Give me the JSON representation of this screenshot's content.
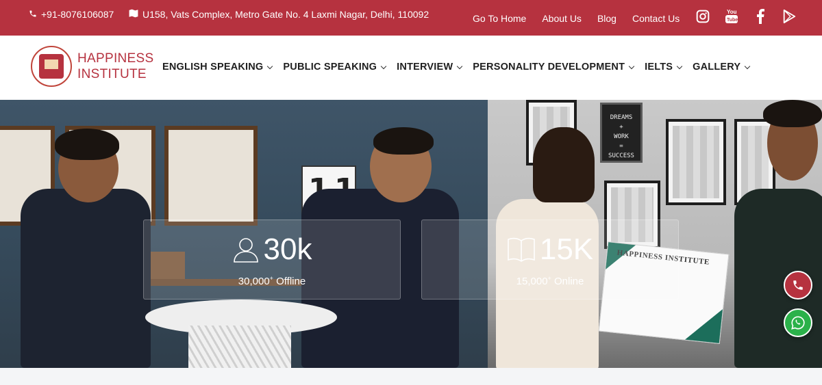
{
  "topbar": {
    "phone": "+91-8076106087",
    "address": "U158, Vats Complex, Metro Gate No. 4 Laxmi Nagar, Delhi, 110092",
    "links": [
      "Go To Home",
      "About Us",
      "Blog",
      "Contact Us"
    ],
    "social_icons": [
      "instagram-icon",
      "youtube-icon",
      "facebook-icon",
      "play-store-icon"
    ],
    "bg_color": "#b6323f"
  },
  "header": {
    "logo_line1": "HAPPINESS",
    "logo_line2": "INSTITUTE",
    "nav": [
      "ENGLISH SPEAKING",
      "PUBLIC SPEAKING",
      "INTERVIEW",
      "PERSONALITY DEVELOPMENT",
      "IELTS",
      "GALLERY"
    ]
  },
  "hero": {
    "clock_digits": [
      "1",
      "1"
    ],
    "board_text": [
      "DREAMS",
      "+",
      "WORK",
      "=",
      "SUCCESS"
    ],
    "certificate_title": "HAPPINESS INSTITUTE",
    "stats": [
      {
        "icon": "user-icon",
        "big": "30k",
        "sub_number": "30,000",
        "sub_sup": "+",
        "sub_label": "Offline"
      },
      {
        "icon": "book-icon",
        "big": "15K",
        "sub_number": "15,000",
        "sub_sup": "+",
        "sub_label": "Online"
      }
    ]
  },
  "floating": {
    "phone_icon": "phone-icon",
    "whatsapp_icon": "whatsapp-icon"
  }
}
